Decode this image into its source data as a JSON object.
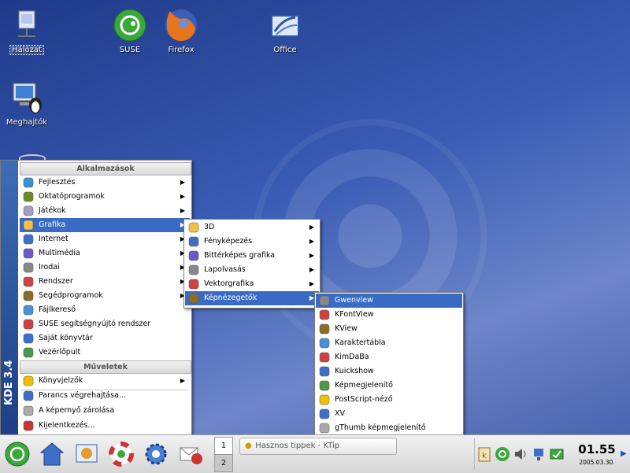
{
  "desktop_icons": [
    {
      "label": "Hálózat",
      "icon": "network-icon",
      "selected": true
    },
    {
      "label": "SUSE",
      "icon": "suse-icon"
    },
    {
      "label": "Firefox",
      "icon": "firefox-icon"
    },
    {
      "label": "Office",
      "icon": "office-icon"
    },
    {
      "label": "Meghajtók",
      "icon": "drives-icon"
    }
  ],
  "kmenu": {
    "sidebar_label": "KDE 3.4",
    "section_apps": "Alkalmazások",
    "section_actions": "Műveletek",
    "items": [
      {
        "label": "Fejlesztés",
        "icon": "development-icon",
        "submenu": true
      },
      {
        "label": "Oktatóprogramok",
        "icon": "education-icon",
        "submenu": true
      },
      {
        "label": "Játékok",
        "icon": "games-icon",
        "submenu": true
      },
      {
        "label": "Grafika",
        "icon": "graphics-icon",
        "submenu": true
      },
      {
        "label": "Internet",
        "icon": "internet-icon",
        "submenu": true
      },
      {
        "label": "Multimédia",
        "icon": "multimedia-icon",
        "submenu": true
      },
      {
        "label": "Irodai",
        "icon": "office-apps-icon",
        "submenu": true
      },
      {
        "label": "Rendszer",
        "icon": "system-icon",
        "submenu": true
      },
      {
        "label": "Segédprogramok",
        "icon": "utilities-icon",
        "submenu": true
      },
      {
        "label": "Fájlkereső",
        "icon": "find-files-icon"
      },
      {
        "label": "SUSE segítségnyújtó rendszer",
        "icon": "help-icon"
      },
      {
        "label": "Saját könyvtár",
        "icon": "home-icon"
      },
      {
        "label": "Vezérlőpult",
        "icon": "control-center-icon"
      }
    ],
    "actions": [
      {
        "label": "Könyvjelzők",
        "icon": "bookmarks-icon",
        "submenu": true
      },
      {
        "label": "Parancs végrehajtása...",
        "icon": "run-command-icon"
      },
      {
        "label": "A képernyő zárolása",
        "icon": "lock-screen-icon"
      },
      {
        "label": "Kijelentkezés...",
        "icon": "logout-icon"
      }
    ]
  },
  "graphics_menu": [
    {
      "label": "3D",
      "icon": "3d-icon"
    },
    {
      "label": "Fényképezés",
      "icon": "photography-icon"
    },
    {
      "label": "Bittérképes grafika",
      "icon": "raster-graphics-icon"
    },
    {
      "label": "Lapolvasás",
      "icon": "scanning-icon"
    },
    {
      "label": "Vektorgrafika",
      "icon": "vector-graphics-icon"
    },
    {
      "label": "Képnézegetők",
      "icon": "image-viewers-icon"
    }
  ],
  "viewers_menu": [
    {
      "label": "Gwenview",
      "icon": "gwenview-icon"
    },
    {
      "label": "KFontView",
      "icon": "kfontview-icon"
    },
    {
      "label": "KView",
      "icon": "kview-icon"
    },
    {
      "label": "Karaktertábla",
      "icon": "charmap-icon"
    },
    {
      "label": "KimDaBa",
      "icon": "kimdaba-icon"
    },
    {
      "label": "Kuickshow",
      "icon": "kuickshow-icon"
    },
    {
      "label": "Képmegjelenítő",
      "icon": "image-display-icon"
    },
    {
      "label": "PostScript-néző",
      "icon": "postscript-viewer-icon"
    },
    {
      "label": "XV",
      "icon": "xv-icon"
    },
    {
      "label": "gThumb képmegjelenítő",
      "icon": "gthumb-icon"
    }
  ],
  "taskbar": {
    "pager": [
      "1",
      "2"
    ],
    "task_label": "Hasznos tippek - KTip",
    "clock_time": "01.55",
    "clock_date": "2005.03.30."
  },
  "colors": {
    "highlight": "#3a6bc4",
    "desktop": "#3a5cb5"
  }
}
